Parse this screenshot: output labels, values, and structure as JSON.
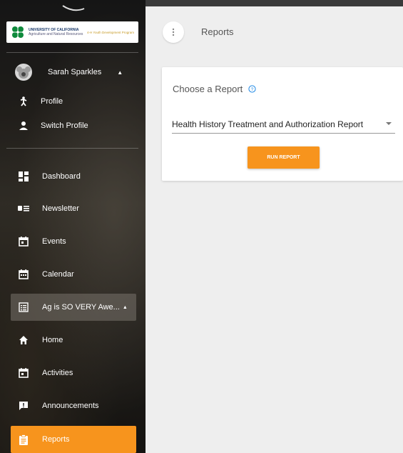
{
  "branding": {
    "logo_university": "UNIVERSITY OF CALIFORNIA",
    "logo_division": "Agriculture and Natural Resources",
    "logo_program": "4-H Youth Development Program"
  },
  "user": {
    "name": "Sarah Sparkles"
  },
  "profile_menu": [
    {
      "label": "Profile",
      "icon": "person-walking-icon"
    },
    {
      "label": "Switch Profile",
      "icon": "person-icon"
    }
  ],
  "nav": {
    "dashboard": "Dashboard",
    "newsletter": "Newsletter",
    "events": "Events",
    "calendar": "Calendar",
    "group": "Ag is SO VERY Awe...",
    "home": "Home",
    "activities": "Activities",
    "announcements": "Announcements",
    "reports": "Reports"
  },
  "header": {
    "title": "Reports"
  },
  "card": {
    "title": "Choose a Report",
    "selected_report": "Health History Treatment and Authorization Report",
    "run_label": "RUN REPORT"
  },
  "colors": {
    "accent": "#f7941d",
    "sidebar_dark": "#1d1d1d",
    "background": "#eeeeee"
  }
}
